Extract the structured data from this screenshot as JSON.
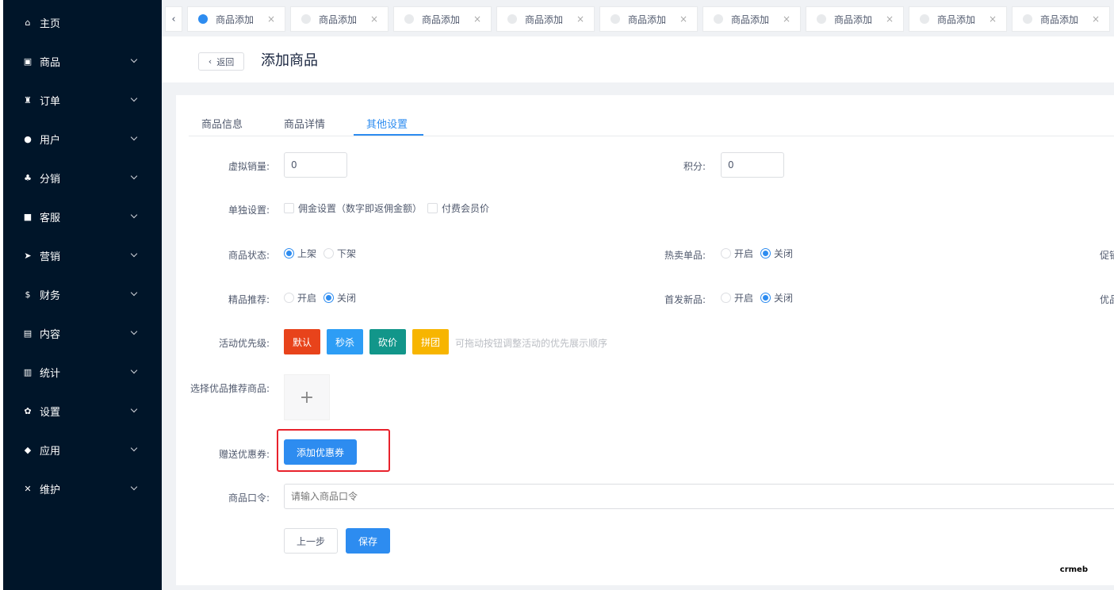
{
  "sidebar": {
    "items": [
      {
        "label": "主页",
        "icon": "home-icon",
        "glyph": "⌂"
      },
      {
        "label": "商品",
        "icon": "basket-icon",
        "glyph": "▣"
      },
      {
        "label": "订单",
        "icon": "cart-icon",
        "glyph": "♜"
      },
      {
        "label": "用户",
        "icon": "user-icon",
        "glyph": "●"
      },
      {
        "label": "分销",
        "icon": "users-icon",
        "glyph": "♣"
      },
      {
        "label": "客服",
        "icon": "chat-icon",
        "glyph": "■"
      },
      {
        "label": "营销",
        "icon": "send-icon",
        "glyph": "➤"
      },
      {
        "label": "财务",
        "icon": "dollar-icon",
        "glyph": "$"
      },
      {
        "label": "内容",
        "icon": "book-icon",
        "glyph": "▤"
      },
      {
        "label": "统计",
        "icon": "bar-chart-icon",
        "glyph": "▥"
      },
      {
        "label": "设置",
        "icon": "gear-icon",
        "glyph": "✿"
      },
      {
        "label": "应用",
        "icon": "cube-icon",
        "glyph": "◆"
      },
      {
        "label": "维护",
        "icon": "hammer-icon",
        "glyph": "✕"
      }
    ]
  },
  "tabbar": {
    "tabs": [
      "商品添加",
      "商品添加",
      "商品添加",
      "商品添加",
      "商品添加",
      "商品添加",
      "商品添加",
      "商品添加",
      "商品添加"
    ],
    "close_glyph": "×",
    "back_glyph": "‹"
  },
  "header": {
    "back_label": "返回",
    "back_glyph": "‹",
    "title": "添加商品"
  },
  "content_tabs": [
    "商品信息",
    "商品详情",
    "其他设置"
  ],
  "form": {
    "virtual_sales": {
      "label": "虚拟销量:",
      "value": "0"
    },
    "points": {
      "label": "积分:",
      "value": "0"
    },
    "separate_settings": {
      "label": "单独设置:",
      "opt1": "佣金设置（数字即返佣金额）",
      "opt2": "付费会员价"
    },
    "status": {
      "label": "商品状态:",
      "on": "上架",
      "off": "下架"
    },
    "hot": {
      "label": "热卖单品:",
      "on": "开启",
      "off": "关闭"
    },
    "promo_cut": "促销",
    "recommend": {
      "label": "精品推荐:",
      "on": "开启",
      "off": "关闭"
    },
    "new_first": {
      "label": "首发新品:",
      "on": "开启",
      "off": "关闭"
    },
    "quality_cut": "优品",
    "priority": {
      "label": "活动优先级:",
      "buttons": [
        {
          "label": "默认",
          "color": "#e8431b"
        },
        {
          "label": "秒杀",
          "color": "#2d9df5"
        },
        {
          "label": "砍价",
          "color": "#12968a"
        },
        {
          "label": "拼团",
          "color": "#f7b500"
        }
      ],
      "hint": "可拖动按钮调整活动的优先展示顺序"
    },
    "recommend_goods": {
      "label": "选择优品推荐商品:",
      "plus": "+"
    },
    "coupon": {
      "label": "赠送优惠券:",
      "button": "添加优惠券"
    },
    "command": {
      "label": "商品口令:",
      "placeholder": "请输入商品口令"
    },
    "prev_button": "上一步",
    "save_button": "保存"
  },
  "watermark": "crmeb",
  "colors": {
    "sidebar_bg": "#001529",
    "primary": "#2d8cf0",
    "highlight": "#e8222c"
  }
}
